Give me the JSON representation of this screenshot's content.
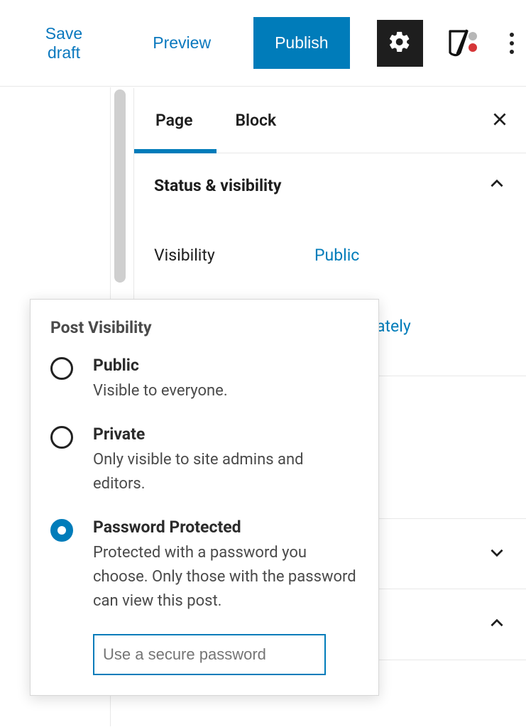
{
  "toolbar": {
    "save_draft": "Save draft",
    "preview": "Preview",
    "publish": "Publish"
  },
  "sidebar": {
    "tabs": {
      "page": "Page",
      "block": "Block"
    },
    "panel_status_title": "Status & visibility",
    "visibility_label": "Visibility",
    "visibility_value": "Public",
    "publish_value_tail": "ately"
  },
  "popover": {
    "title": "Post Visibility",
    "options": [
      {
        "label": "Public",
        "desc": "Visible to everyone."
      },
      {
        "label": "Private",
        "desc": "Only visible to site admins and editors."
      },
      {
        "label": "Password Protected",
        "desc": "Protected with a password you choose. Only those with the password can view this post."
      }
    ],
    "password_placeholder": "Use a secure password"
  }
}
